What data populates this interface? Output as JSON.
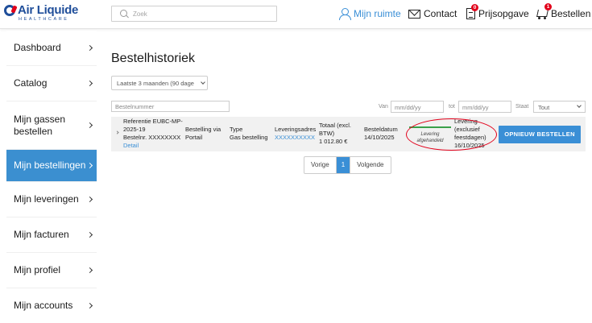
{
  "header": {
    "logo": {
      "brand": "Air Liquide",
      "sub": "HEALTHCARE"
    },
    "search": {
      "placeholder": "Zoek",
      "value": ""
    },
    "nav": {
      "account": "Mijn ruimte",
      "contact": "Contact",
      "quote": "Prijsopgave",
      "quote_count": "0",
      "order": "Bestellen",
      "order_count": "1"
    }
  },
  "sidebar": {
    "items": [
      {
        "label": "Dashboard",
        "active": false
      },
      {
        "label": "Catalog",
        "active": false
      },
      {
        "label": "Mijn gassen bestellen",
        "active": false
      },
      {
        "label": "Mijn bestellingen",
        "active": true
      },
      {
        "label": "Mijn leveringen",
        "active": false
      },
      {
        "label": "Mijn facturen",
        "active": false
      },
      {
        "label": "Mijn profiel",
        "active": false
      },
      {
        "label": "Mijn accounts",
        "active": false
      }
    ]
  },
  "main": {
    "title": "Bestelhistoriek",
    "period_select": "Laatste 3 maanden (90 dage",
    "filters": {
      "order_number_placeholder": "Bestelnummer",
      "from_label": "Van",
      "from_placeholder": "mm/dd/yy",
      "to_label": "tot",
      "to_placeholder": "mm/dd/yy",
      "state_label": "Staat",
      "state_value": "Tout"
    },
    "order": {
      "reference_line1": "Referentie EUBC-MP-",
      "reference_line2": "2025-19",
      "order_number": "Bestelnr. XXXXXXXX",
      "detail_link": "Detail",
      "via_label": "Bestelling via",
      "via_value": "Portail",
      "type_label": "Type",
      "type_value": "Gas bestelling",
      "address_label": "Leveringsadres",
      "address_value": "XXXXXXXXXX",
      "total_label_1": "Totaal (excl.",
      "total_label_2": "BTW)",
      "total_value": "1 012.80 €",
      "date_label": "Besteldatum",
      "date_value": "14/10/2025",
      "status_label_1": "Levering",
      "status_label_2": "afgehandeld",
      "status_progress": 1.0,
      "delivery_1": "Levering",
      "delivery_2": "(exclusief",
      "delivery_3": "feestdagen)",
      "delivery_date": "16/10/2025",
      "reorder_button": "OPNIEUW BESTELLEN"
    },
    "pagination": {
      "prev": "Vorige",
      "current": "1",
      "next": "Volgende"
    }
  },
  "colors": {
    "accent": "#3a8fd6",
    "sidebar_active": "#3b8fd0",
    "highlight_circle": "#e2001a",
    "progress": "#3aa04a"
  }
}
